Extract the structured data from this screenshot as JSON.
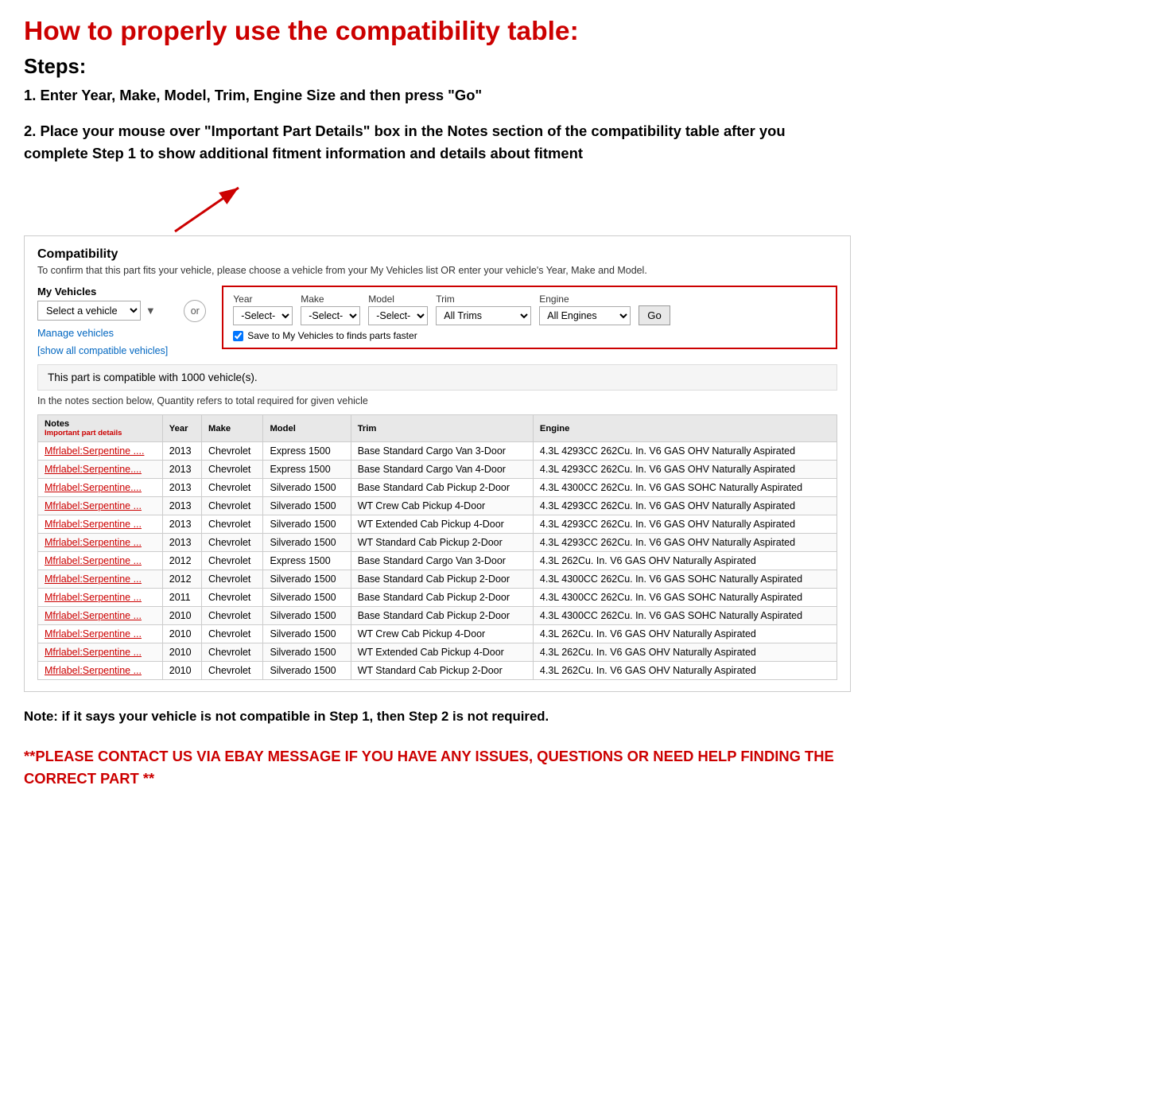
{
  "page": {
    "main_title": "How to properly use the compatibility table:",
    "steps_title": "Steps:",
    "step1": "1. Enter Year, Make, Model, Trim, Engine Size and then press \"Go\"",
    "step2": "2. Place your mouse over \"Important Part Details\" box in the Notes section of the compatibility table after you complete Step 1 to show additional fitment information and details about fitment",
    "note": "Note: if it says your vehicle is not compatible in Step 1, then Step 2 is not required.",
    "contact": "**PLEASE CONTACT US VIA EBAY MESSAGE IF YOU HAVE ANY ISSUES, QUESTIONS OR NEED HELP FINDING THE CORRECT PART **"
  },
  "compatibility": {
    "title": "Compatibility",
    "subtitle": "To confirm that this part fits your vehicle, please choose a vehicle from your My Vehicles list OR enter your vehicle's Year, Make and Model.",
    "my_vehicles_label": "My Vehicles",
    "select_vehicle_placeholder": "Select a vehicle",
    "manage_link": "Manage vehicles",
    "show_link": "[show all compatible vehicles]",
    "or_label": "or",
    "year_label": "Year",
    "make_label": "Make",
    "model_label": "Model",
    "trim_label": "Trim",
    "engine_label": "Engine",
    "year_value": "-Select-",
    "make_value": "-Select-",
    "model_value": "-Select-",
    "trim_value": "All Trims",
    "engine_value": "All Engines",
    "go_label": "Go",
    "save_label": "Save to My Vehicles to finds parts faster",
    "compat_info": "This part is compatible with 1000 vehicle(s).",
    "compat_note": "In the notes section below, Quantity refers to total required for given vehicle",
    "table": {
      "headers": [
        "Notes",
        "Year",
        "Make",
        "Model",
        "Trim",
        "Engine"
      ],
      "notes_sub": "Important part details",
      "rows": [
        {
          "notes": "Mfrlabel:Serpentine ....",
          "year": "2013",
          "make": "Chevrolet",
          "model": "Express 1500",
          "trim": "Base Standard Cargo Van 3-Door",
          "engine": "4.3L 4293CC 262Cu. In. V6 GAS OHV Naturally Aspirated"
        },
        {
          "notes": "Mfrlabel:Serpentine....",
          "year": "2013",
          "make": "Chevrolet",
          "model": "Express 1500",
          "trim": "Base Standard Cargo Van 4-Door",
          "engine": "4.3L 4293CC 262Cu. In. V6 GAS OHV Naturally Aspirated"
        },
        {
          "notes": "Mfrlabel:Serpentine....",
          "year": "2013",
          "make": "Chevrolet",
          "model": "Silverado 1500",
          "trim": "Base Standard Cab Pickup 2-Door",
          "engine": "4.3L 4300CC 262Cu. In. V6 GAS SOHC Naturally Aspirated"
        },
        {
          "notes": "Mfrlabel:Serpentine ...",
          "year": "2013",
          "make": "Chevrolet",
          "model": "Silverado 1500",
          "trim": "WT Crew Cab Pickup 4-Door",
          "engine": "4.3L 4293CC 262Cu. In. V6 GAS OHV Naturally Aspirated"
        },
        {
          "notes": "Mfrlabel:Serpentine ...",
          "year": "2013",
          "make": "Chevrolet",
          "model": "Silverado 1500",
          "trim": "WT Extended Cab Pickup 4-Door",
          "engine": "4.3L 4293CC 262Cu. In. V6 GAS OHV Naturally Aspirated"
        },
        {
          "notes": "Mfrlabel:Serpentine ...",
          "year": "2013",
          "make": "Chevrolet",
          "model": "Silverado 1500",
          "trim": "WT Standard Cab Pickup 2-Door",
          "engine": "4.3L 4293CC 262Cu. In. V6 GAS OHV Naturally Aspirated"
        },
        {
          "notes": "Mfrlabel:Serpentine ...",
          "year": "2012",
          "make": "Chevrolet",
          "model": "Express 1500",
          "trim": "Base Standard Cargo Van 3-Door",
          "engine": "4.3L 262Cu. In. V6 GAS OHV Naturally Aspirated"
        },
        {
          "notes": "Mfrlabel:Serpentine ...",
          "year": "2012",
          "make": "Chevrolet",
          "model": "Silverado 1500",
          "trim": "Base Standard Cab Pickup 2-Door",
          "engine": "4.3L 4300CC 262Cu. In. V6 GAS SOHC Naturally Aspirated"
        },
        {
          "notes": "Mfrlabel:Serpentine ...",
          "year": "2011",
          "make": "Chevrolet",
          "model": "Silverado 1500",
          "trim": "Base Standard Cab Pickup 2-Door",
          "engine": "4.3L 4300CC 262Cu. In. V6 GAS SOHC Naturally Aspirated"
        },
        {
          "notes": "Mfrlabel:Serpentine ...",
          "year": "2010",
          "make": "Chevrolet",
          "model": "Silverado 1500",
          "trim": "Base Standard Cab Pickup 2-Door",
          "engine": "4.3L 4300CC 262Cu. In. V6 GAS SOHC Naturally Aspirated"
        },
        {
          "notes": "Mfrlabel:Serpentine ...",
          "year": "2010",
          "make": "Chevrolet",
          "model": "Silverado 1500",
          "trim": "WT Crew Cab Pickup 4-Door",
          "engine": "4.3L 262Cu. In. V6 GAS OHV Naturally Aspirated"
        },
        {
          "notes": "Mfrlabel:Serpentine ...",
          "year": "2010",
          "make": "Chevrolet",
          "model": "Silverado 1500",
          "trim": "WT Extended Cab Pickup 4-Door",
          "engine": "4.3L 262Cu. In. V6 GAS OHV Naturally Aspirated"
        },
        {
          "notes": "Mfrlabel:Serpentine ...",
          "year": "2010",
          "make": "Chevrolet",
          "model": "Silverado 1500",
          "trim": "WT Standard Cab Pickup 2-Door",
          "engine": "4.3L 262Cu. In. V6 GAS OHV Naturally Aspirated"
        }
      ]
    }
  }
}
